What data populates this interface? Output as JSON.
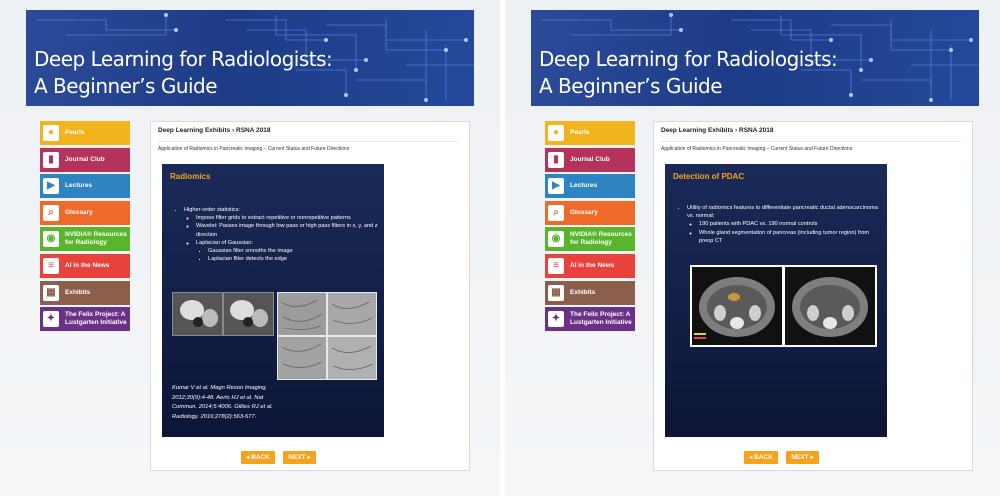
{
  "banner": {
    "title_line1": "Deep Learning for Radiologists:",
    "title_line2": "A Beginner’s Guide"
  },
  "nav": [
    {
      "label": "Pearls",
      "icon": "pearls-icon",
      "color": "#f2b41c"
    },
    {
      "label": "Journal Club",
      "icon": "book-icon",
      "color": "#b5325b"
    },
    {
      "label": "Lectures",
      "icon": "play-icon",
      "color": "#2e83c2"
    },
    {
      "label": "Glossary",
      "icon": "glossary-icon",
      "color": "#ee6a2b"
    },
    {
      "label": "NVIDIA® Resources for Radiology",
      "icon": "nvidia-icon",
      "color": "#59b62c"
    },
    {
      "label": "AI in the News",
      "icon": "news-icon",
      "color": "#e9423d"
    },
    {
      "label": "Exhibits",
      "icon": "exhibits-icon",
      "color": "#8c5f4c"
    },
    {
      "label": "The Felix Project: A Lustgarten Initiative",
      "icon": "felix-icon",
      "color": "#6b3087"
    }
  ],
  "breadcrumb": "Deep Learning Exhibits › RSNA 2018",
  "subtitle": "Application of Radiomics in Pancreatic Imaging – Current Status and Future Directions",
  "left_slide": {
    "title": "Radiomics",
    "bullet": "Higher-order statistics:",
    "items": [
      "Impose filter grids to extract repetitive or nonrepetitive patterns",
      "Wavelet: Passes image through low pass or high pass filters in x, y, and z direction",
      "Laplacian of Gaussian:"
    ],
    "subitems": [
      "Gaussian filter smooths the image",
      "Laplacian filter detects the edge"
    ],
    "reference": "Kumar V et al. Magn Reson Imaging. 2012;30(9):4-48. Aerts HJ et al. Nat Commun. 2014;5:4006. Gillies RJ et al. Radiology. 2016;278(2):563-577."
  },
  "right_slide": {
    "title": "Detection of PDAC",
    "bullet": "Utility of radiomics features to differentiate pancreatic ductal adenocarcinoma vs. normal:",
    "items": [
      "190 patients with PDAC vs. 190 normal controls",
      "Whole gland segmentation of pancreas (including tumor region) from preop CT"
    ]
  },
  "buttons": {
    "back": "◂ BACK",
    "next": "NEXT ▸"
  },
  "colors": {
    "accent": "#f6a21a",
    "slide_bg": "#111d45",
    "banner_bg": "#21428f"
  }
}
